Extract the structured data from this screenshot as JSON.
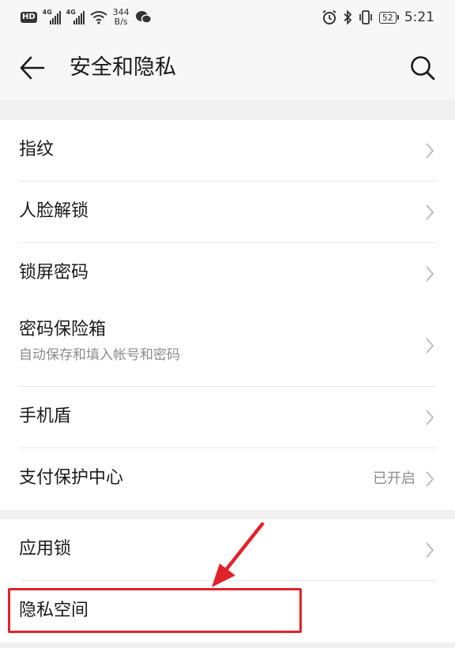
{
  "status_bar": {
    "hd": "HD",
    "network1": "4G",
    "network2": "4G",
    "speed_value": "344",
    "speed_unit": "B/s",
    "battery": "52",
    "time": "5:21"
  },
  "header": {
    "title": "安全和隐私"
  },
  "groups": [
    {
      "items": [
        {
          "label": "指纹"
        },
        {
          "label": "人脸解锁"
        },
        {
          "label": "锁屏密码"
        }
      ]
    },
    {
      "items": [
        {
          "label": "密码保险箱",
          "sub": "自动保存和填入帐号和密码"
        },
        {
          "label": "手机盾"
        },
        {
          "label": "支付保护中心",
          "value": "已开启"
        }
      ]
    },
    {
      "items": [
        {
          "label": "应用锁"
        },
        {
          "label": "隐私空间"
        }
      ]
    }
  ],
  "colors": {
    "highlight": "#e0232a",
    "background": "#f1f1f1",
    "card": "#ffffff",
    "secondary_text": "#8c8c8c"
  },
  "icons": [
    "back-arrow-icon",
    "search-icon",
    "chevron-right-icon",
    "wifi-icon",
    "wechat-icon",
    "alarm-icon",
    "bluetooth-icon",
    "vibrate-icon",
    "battery-icon"
  ]
}
